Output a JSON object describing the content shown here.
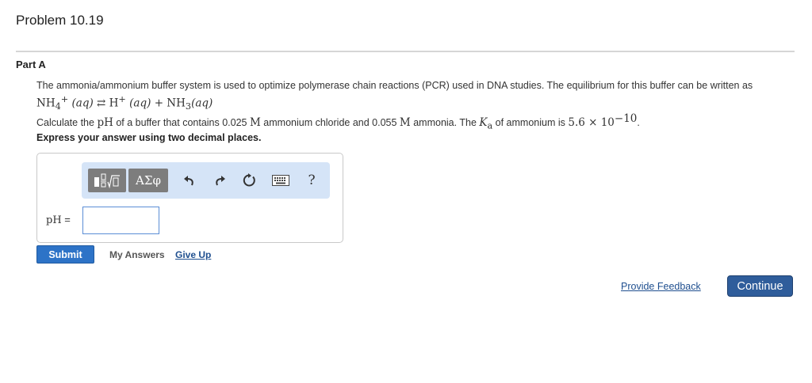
{
  "problem": {
    "title": "Problem 10.19"
  },
  "part": {
    "label": "Part A"
  },
  "question": {
    "intro": "The ammonia/ammonium buffer system is used to optimize polymerase chain reactions (PCR) used in DNA studies. The equilibrium for this buffer can be written as",
    "equation": {
      "reactant": "NH",
      "reactant_sub": "4",
      "reactant_sup": "+",
      "phase1": "(aq)",
      "arrow": "⇄",
      "product1": "H",
      "product1_sup": "+",
      "phase2": "(aq)",
      "plus": "+",
      "product2": "NH",
      "product2_sub": "3",
      "phase3": "(aq)"
    },
    "calc": {
      "t1": "Calculate the ",
      "ph": "pH",
      "t2": " of a buffer that contains 0.025 ",
      "unit1": "M",
      "t3": " ammonium chloride and 0.055 ",
      "unit2": "M",
      "t4": " ammonia. The ",
      "k": "K",
      "k_sub": "a",
      "t5": " of ammonium is ",
      "value": "5.6 × 10",
      "exponent": "−10",
      "end": "."
    },
    "instruction": "Express your answer using two decimal places."
  },
  "toolbar": {
    "templates_icon": "templates-icon",
    "greek_label": "ΑΣφ",
    "undo_icon": "undo-icon",
    "redo_icon": "redo-icon",
    "reset_icon": "reset-icon",
    "keyboard_icon": "keyboard-icon",
    "help_label": "?"
  },
  "answer": {
    "label": "pH",
    "equals": " =",
    "value": ""
  },
  "actions": {
    "submit_label": "Submit",
    "my_answers_label": "My Answers",
    "give_up_label": "Give Up"
  },
  "footer": {
    "feedback_label": "Provide Feedback",
    "continue_label": "Continue"
  },
  "colors": {
    "primary": "#2d73c7",
    "continue": "#2f5d9b",
    "link": "#1f4f8f",
    "toolbar_bg": "#d5e4f7"
  }
}
